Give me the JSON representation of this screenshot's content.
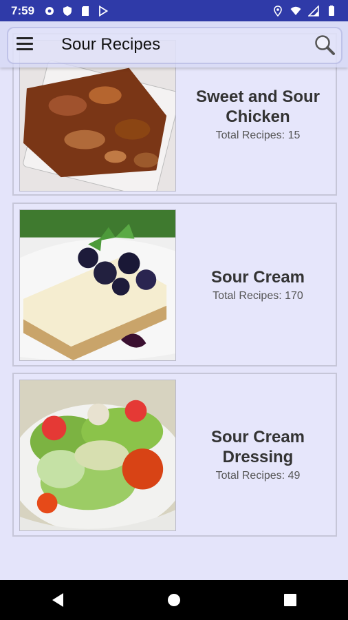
{
  "status_bar": {
    "time": "7:59",
    "icons_left": [
      "gear-icon",
      "shield-icon",
      "sd-card-icon",
      "play-store-icon"
    ],
    "icons_right": [
      "location-icon",
      "wifi-icon",
      "signal-icon",
      "battery-icon"
    ]
  },
  "toolbar": {
    "title": "Sour Recipes",
    "menu_icon": "menu-icon",
    "search_icon": "search-icon"
  },
  "categories": [
    {
      "title": "Sweet and Sour Chicken",
      "title_lines": [
        "Sweet and Sour",
        "Chicken"
      ],
      "count_text": "Total Recipes: 15"
    },
    {
      "title": "Sour Cream",
      "title_lines": [
        "Sour Cream"
      ],
      "count_text": "Total Recipes: 170"
    },
    {
      "title": "Sour Cream Dressing",
      "title_lines": [
        "Sour Cream",
        "Dressing"
      ],
      "count_text": "Total Recipes: 49"
    }
  ],
  "nav_bar": {
    "icons": [
      "back-icon",
      "home-icon",
      "recents-icon"
    ]
  },
  "colors": {
    "status_bar": "#2f3aa8",
    "background": "#e4e4fa",
    "card_border": "#c6c6d8",
    "nav_bar": "#000000"
  }
}
